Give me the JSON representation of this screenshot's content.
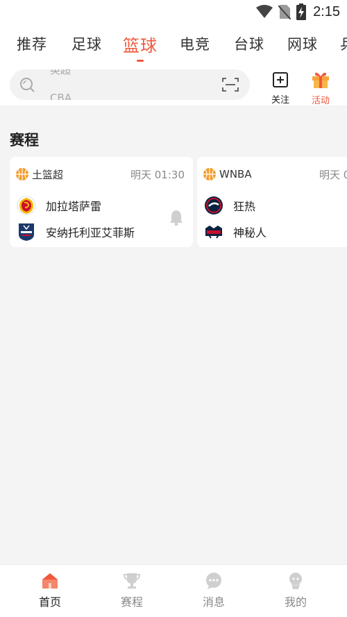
{
  "status_bar": {
    "time": "2:15"
  },
  "category_tabs": [
    {
      "label": "推荐"
    },
    {
      "label": "足球"
    },
    {
      "label": "篮球",
      "active": true
    },
    {
      "label": "电竞"
    },
    {
      "label": "台球"
    },
    {
      "label": "网球"
    },
    {
      "label": "乒"
    }
  ],
  "search": {
    "ticker": [
      "英超",
      "CBA"
    ]
  },
  "actions": {
    "follow_label": "关注",
    "activity_label": "活动"
  },
  "schedule": {
    "title": "赛程",
    "matches": [
      {
        "league": "土篮超",
        "time": "明天 01:30",
        "home": "加拉塔萨雷",
        "away": "安纳托利亚艾菲斯"
      },
      {
        "league": "WNBA",
        "time": "明天 0",
        "home": "狂热",
        "away": "神秘人"
      }
    ]
  },
  "bottom_nav": [
    {
      "label": "首页",
      "icon": "home-icon",
      "active": true
    },
    {
      "label": "赛程",
      "icon": "trophy-icon"
    },
    {
      "label": "消息",
      "icon": "message-icon"
    },
    {
      "label": "我的",
      "icon": "profile-icon"
    }
  ],
  "colors": {
    "accent": "#f0573b",
    "background": "#f4f4f4",
    "card": "#ffffff"
  }
}
